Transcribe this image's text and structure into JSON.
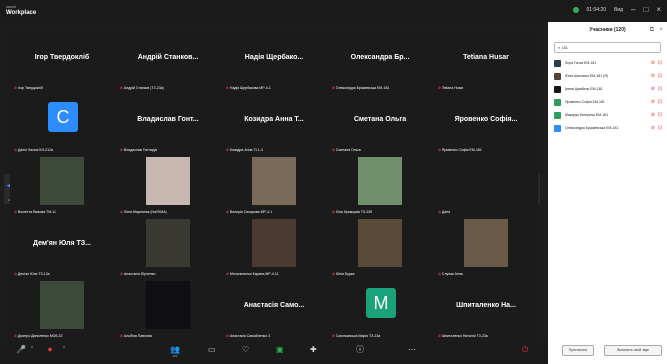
{
  "app": {
    "brand_small": "zoom",
    "brand": "Workplace",
    "status": "01:04:20",
    "dropdown": "Вид"
  },
  "panel": {
    "title": "Учасники (120)",
    "search_value": "181",
    "participants": [
      {
        "name": "Лєра Гонза ЕМ-181",
        "color": "#2f3b4a"
      },
      {
        "name": "Юлія Шаповал ЕМ-181 (Я)",
        "color": "#56402f"
      },
      {
        "name": "Ірина Цимбаль ЕМ-181",
        "color": "#171717"
      },
      {
        "name": "Яровенко Софія ЕМ-181",
        "color": "#2e9d5e"
      },
      {
        "name": "Макарук Катерина ЕМ-181",
        "color": "#2e9d5e"
      },
      {
        "name": "Олександра Бражевська ЕМ-181",
        "color": "#2d8cff"
      }
    ],
    "invite": "Пригласить",
    "unmute": "Включить свой звук"
  },
  "tiles": [
    {
      "name": "Ігор Твердокліб",
      "label": "Ігор Твердокліб"
    },
    {
      "name": "Андрій Станков...",
      "label": "Андрій Станков (ТЗ-23а)"
    },
    {
      "name": "Надія Щербако...",
      "label": "Надія Щербакова МР-4-1"
    },
    {
      "name": "Олександра Бр...",
      "label": "Олександра Бражевська ЕМ-181"
    },
    {
      "name": "Tetiana Husar",
      "label": "Tetiana Husar"
    },
    {
      "avatar": "C",
      "avatar_color": "#2d8cff",
      "label": "Даніл Халюк КН-212а"
    },
    {
      "name": "Владислав Гонт...",
      "label": "Владислав Гонтарук"
    },
    {
      "name": "Козидра Анна Т...",
      "label": "Козидра Анна ТІ-1-4"
    },
    {
      "name": "Сметана Ольга",
      "label": "Сметана Ольга"
    },
    {
      "name": "Яровенко Софія...",
      "label": "Яровенко Софія ЕМ-181"
    },
    {
      "photo": "#3d4a3a",
      "label": "Віолетта Ямкова ТМ-11"
    },
    {
      "photo": "#c9b8b0",
      "label": "Юлія Мартинюк (НаУКМА)"
    },
    {
      "photo": "#7a6a5a",
      "label": "Валерія Сахарова МР-4-1"
    },
    {
      "photo": "#6f8f6a",
      "label": "Ліна Кримцова ТЗ-23б"
    },
    {
      "label": "Даня"
    },
    {
      "name": "Дем'ян Юля ТЗ...",
      "label": "Дем'ян Юля ТЗ-12а"
    },
    {
      "photo": "#3a3a32",
      "label": "Анастасія Юрченко"
    },
    {
      "photo": "#4a3a30",
      "label": "Мельниченко Карина МР-4-11"
    },
    {
      "photo": "#5a4a38",
      "label": "Юлія Бурка"
    },
    {
      "photo": "#6a5a48",
      "label": "Слупак Анна"
    },
    {
      "photo": "#3c4a3a",
      "label": "Дмитро Даниленко МОб-22"
    },
    {
      "photo": "#0f0f14",
      "label": "Альбіна Павлова"
    },
    {
      "name": "Анастасія Само...",
      "label": "Анастасія Самойленко 3"
    },
    {
      "avatar": "M",
      "avatar_color": "#1aa37a",
      "label": "Смольянська Марія ТЗ-23а"
    },
    {
      "name": "Шпиталенко На...",
      "label": "Шпиталенко Наталія ТЗ-23а"
    }
  ],
  "toolbar": {
    "participants_count": "120"
  }
}
